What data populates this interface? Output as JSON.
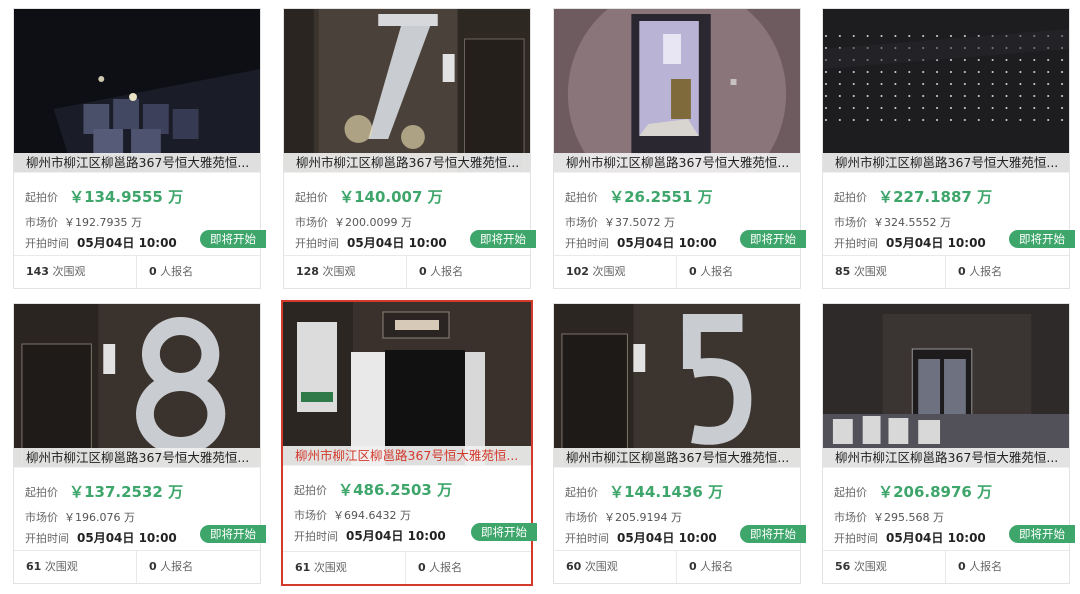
{
  "labels": {
    "start_price": "起拍价",
    "market_price": "市场价",
    "start_time": "开拍时间",
    "badge": "即将开始",
    "views_suffix": "次围观",
    "signups_suffix": "人报名"
  },
  "items": [
    {
      "title": "柳州市柳江区柳邕路367号恒大雅苑恒...",
      "start_price": "￥134.9555 万",
      "market_price": "￥192.7935 万",
      "start_time": "05月04日 10:00",
      "views": "143",
      "signups": "0"
    },
    {
      "title": "柳州市柳江区柳邕路367号恒大雅苑恒...",
      "start_price": "￥140.007 万",
      "market_price": "￥200.0099 万",
      "start_time": "05月04日 10:00",
      "views": "128",
      "signups": "0"
    },
    {
      "title": "柳州市柳江区柳邕路367号恒大雅苑恒...",
      "start_price": "￥26.2551 万",
      "market_price": "￥37.5072 万",
      "start_time": "05月04日 10:00",
      "views": "102",
      "signups": "0"
    },
    {
      "title": "柳州市柳江区柳邕路367号恒大雅苑恒...",
      "start_price": "￥227.1887 万",
      "market_price": "￥324.5552 万",
      "start_time": "05月04日 10:00",
      "views": "85",
      "signups": "0"
    },
    {
      "title": "柳州市柳江区柳邕路367号恒大雅苑恒...",
      "start_price": "￥137.2532 万",
      "market_price": "￥196.076 万",
      "start_time": "05月04日 10:00",
      "views": "61",
      "signups": "0"
    },
    {
      "title": "柳州市柳江区柳邕路367号恒大雅苑恒...",
      "start_price": "￥486.2503 万",
      "market_price": "￥694.6432 万",
      "start_time": "05月04日 10:00",
      "views": "61",
      "signups": "0",
      "selected": true
    },
    {
      "title": "柳州市柳江区柳邕路367号恒大雅苑恒...",
      "start_price": "￥144.1436 万",
      "market_price": "￥205.9194 万",
      "start_time": "05月04日 10:00",
      "views": "60",
      "signups": "0"
    },
    {
      "title": "柳州市柳江区柳邕路367号恒大雅苑恒...",
      "start_price": "￥206.8976 万",
      "market_price": "￥295.568 万",
      "start_time": "05月04日 10:00",
      "views": "56",
      "signups": "0"
    }
  ],
  "colors": {
    "accent_green": "#3ea66b",
    "selected_red": "#d33a2c"
  }
}
